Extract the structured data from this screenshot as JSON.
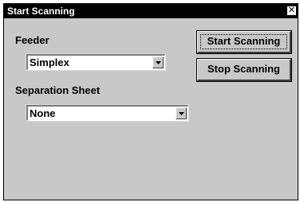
{
  "window": {
    "title": "Start Scanning",
    "close_glyph": "✕"
  },
  "feeder": {
    "label": "Feeder",
    "selected": "Simplex",
    "options": [
      "Simplex"
    ]
  },
  "separation_sheet": {
    "label": "Separation Sheet",
    "selected": "None",
    "options": [
      "None"
    ]
  },
  "buttons": {
    "start_label": "Start Scanning",
    "stop_label": "Stop Scanning"
  },
  "icons": {
    "close": "close-icon",
    "dropdown_arrow": "chevron-down-icon"
  },
  "colors": {
    "dialog_background": "#c8c8c8",
    "titlebar_background": "#000000",
    "titlebar_text": "#ffffff"
  }
}
